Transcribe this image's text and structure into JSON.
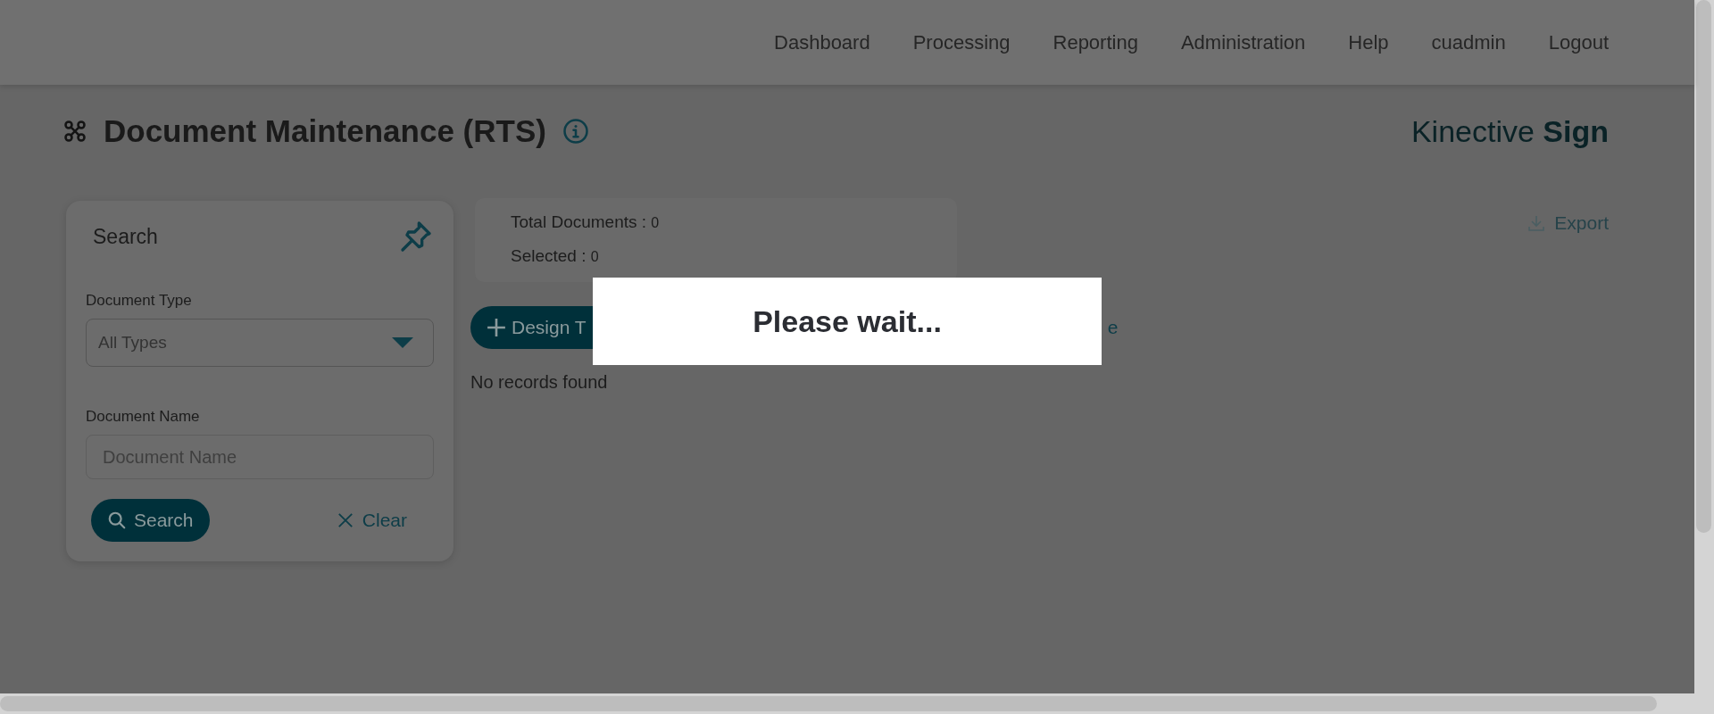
{
  "nav": {
    "items": [
      "Dashboard",
      "Processing",
      "Reporting",
      "Administration",
      "Help",
      "cuadmin",
      "Logout"
    ]
  },
  "page": {
    "title": "Document Maintenance (RTS)",
    "brand": {
      "light": "Kinective",
      "bold": "Sign"
    }
  },
  "search_panel": {
    "title": "Search",
    "document_type": {
      "label": "Document Type",
      "value": "All Types"
    },
    "document_name": {
      "label": "Document Name",
      "placeholder": "Document Name"
    },
    "search_button": "Search",
    "clear_button": "Clear"
  },
  "summary": {
    "total_label": "Total Documents :",
    "total_value": "0",
    "selected_label": "Selected :",
    "selected_value": "0"
  },
  "design_button": "Design T",
  "partial_link": "e",
  "empty_message": "No records found",
  "export_button": "Export",
  "loading_dialog": {
    "message": "Please wait..."
  }
}
